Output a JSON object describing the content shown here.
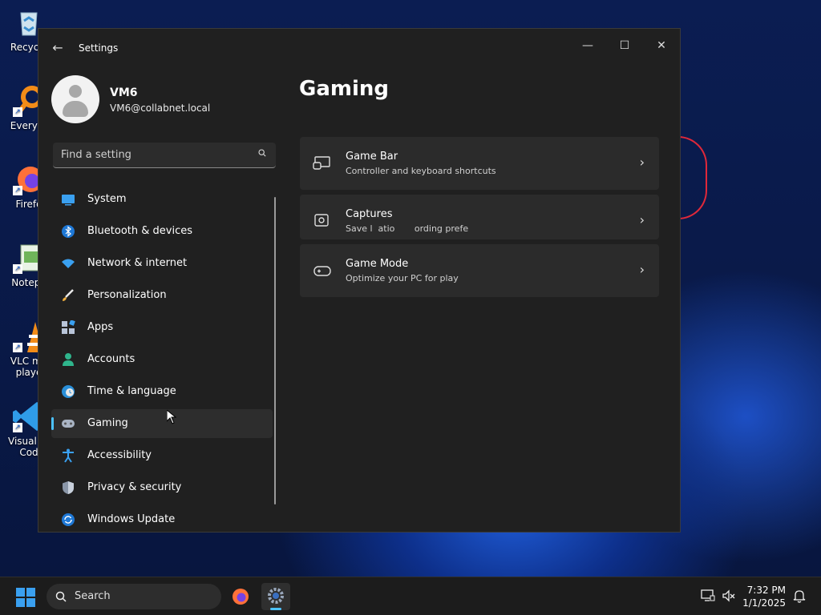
{
  "desktop": {
    "icons": [
      {
        "label": "Recycle",
        "name": "recycle-bin-icon"
      },
      {
        "label": "Everyth",
        "name": "everything-icon"
      },
      {
        "label": "Firefo",
        "name": "firefox-icon"
      },
      {
        "label": "Notepa",
        "name": "notepad-icon"
      },
      {
        "label": "VLC me",
        "label2": "playe",
        "name": "vlc-icon"
      },
      {
        "label": "Visual St",
        "label2": "Cod",
        "name": "vscode-icon"
      }
    ]
  },
  "window": {
    "title": "Settings",
    "controls": {
      "minimize": "—",
      "maximize": "☐",
      "close": "✕"
    }
  },
  "profile": {
    "name": "VM6",
    "email": "VM6@collabnet.local"
  },
  "search": {
    "placeholder": "Find a setting"
  },
  "nav": {
    "items": [
      {
        "label": "System",
        "icon": "system-icon"
      },
      {
        "label": "Bluetooth & devices",
        "icon": "bluetooth-icon"
      },
      {
        "label": "Network & internet",
        "icon": "network-icon"
      },
      {
        "label": "Personalization",
        "icon": "brush-icon"
      },
      {
        "label": "Apps",
        "icon": "apps-icon"
      },
      {
        "label": "Accounts",
        "icon": "accounts-icon"
      },
      {
        "label": "Time & language",
        "icon": "globe-clock-icon"
      },
      {
        "label": "Gaming",
        "icon": "gamepad-icon",
        "active": true
      },
      {
        "label": "Accessibility",
        "icon": "accessibility-icon"
      },
      {
        "label": "Privacy & security",
        "icon": "shield-icon"
      },
      {
        "label": "Windows Update",
        "icon": "update-icon"
      }
    ]
  },
  "page": {
    "title": "Gaming",
    "cards": [
      {
        "title": "Game Bar",
        "subtitle": "Controller and keyboard shortcuts",
        "icon": "game-bar-icon"
      },
      {
        "title": "Captures",
        "subtitle": "Save l  atio       ording prefe",
        "icon": "captures-icon"
      },
      {
        "title": "Game Mode",
        "subtitle": "Optimize your PC for play",
        "icon": "game-mode-icon"
      }
    ]
  },
  "taskbar": {
    "search_label": "Search",
    "time": "7:32 PM",
    "date": "1/1/2025"
  },
  "colors": {
    "accent": "#4cc2ff",
    "window_bg": "#202020",
    "card_bg": "#2b2b2b"
  }
}
